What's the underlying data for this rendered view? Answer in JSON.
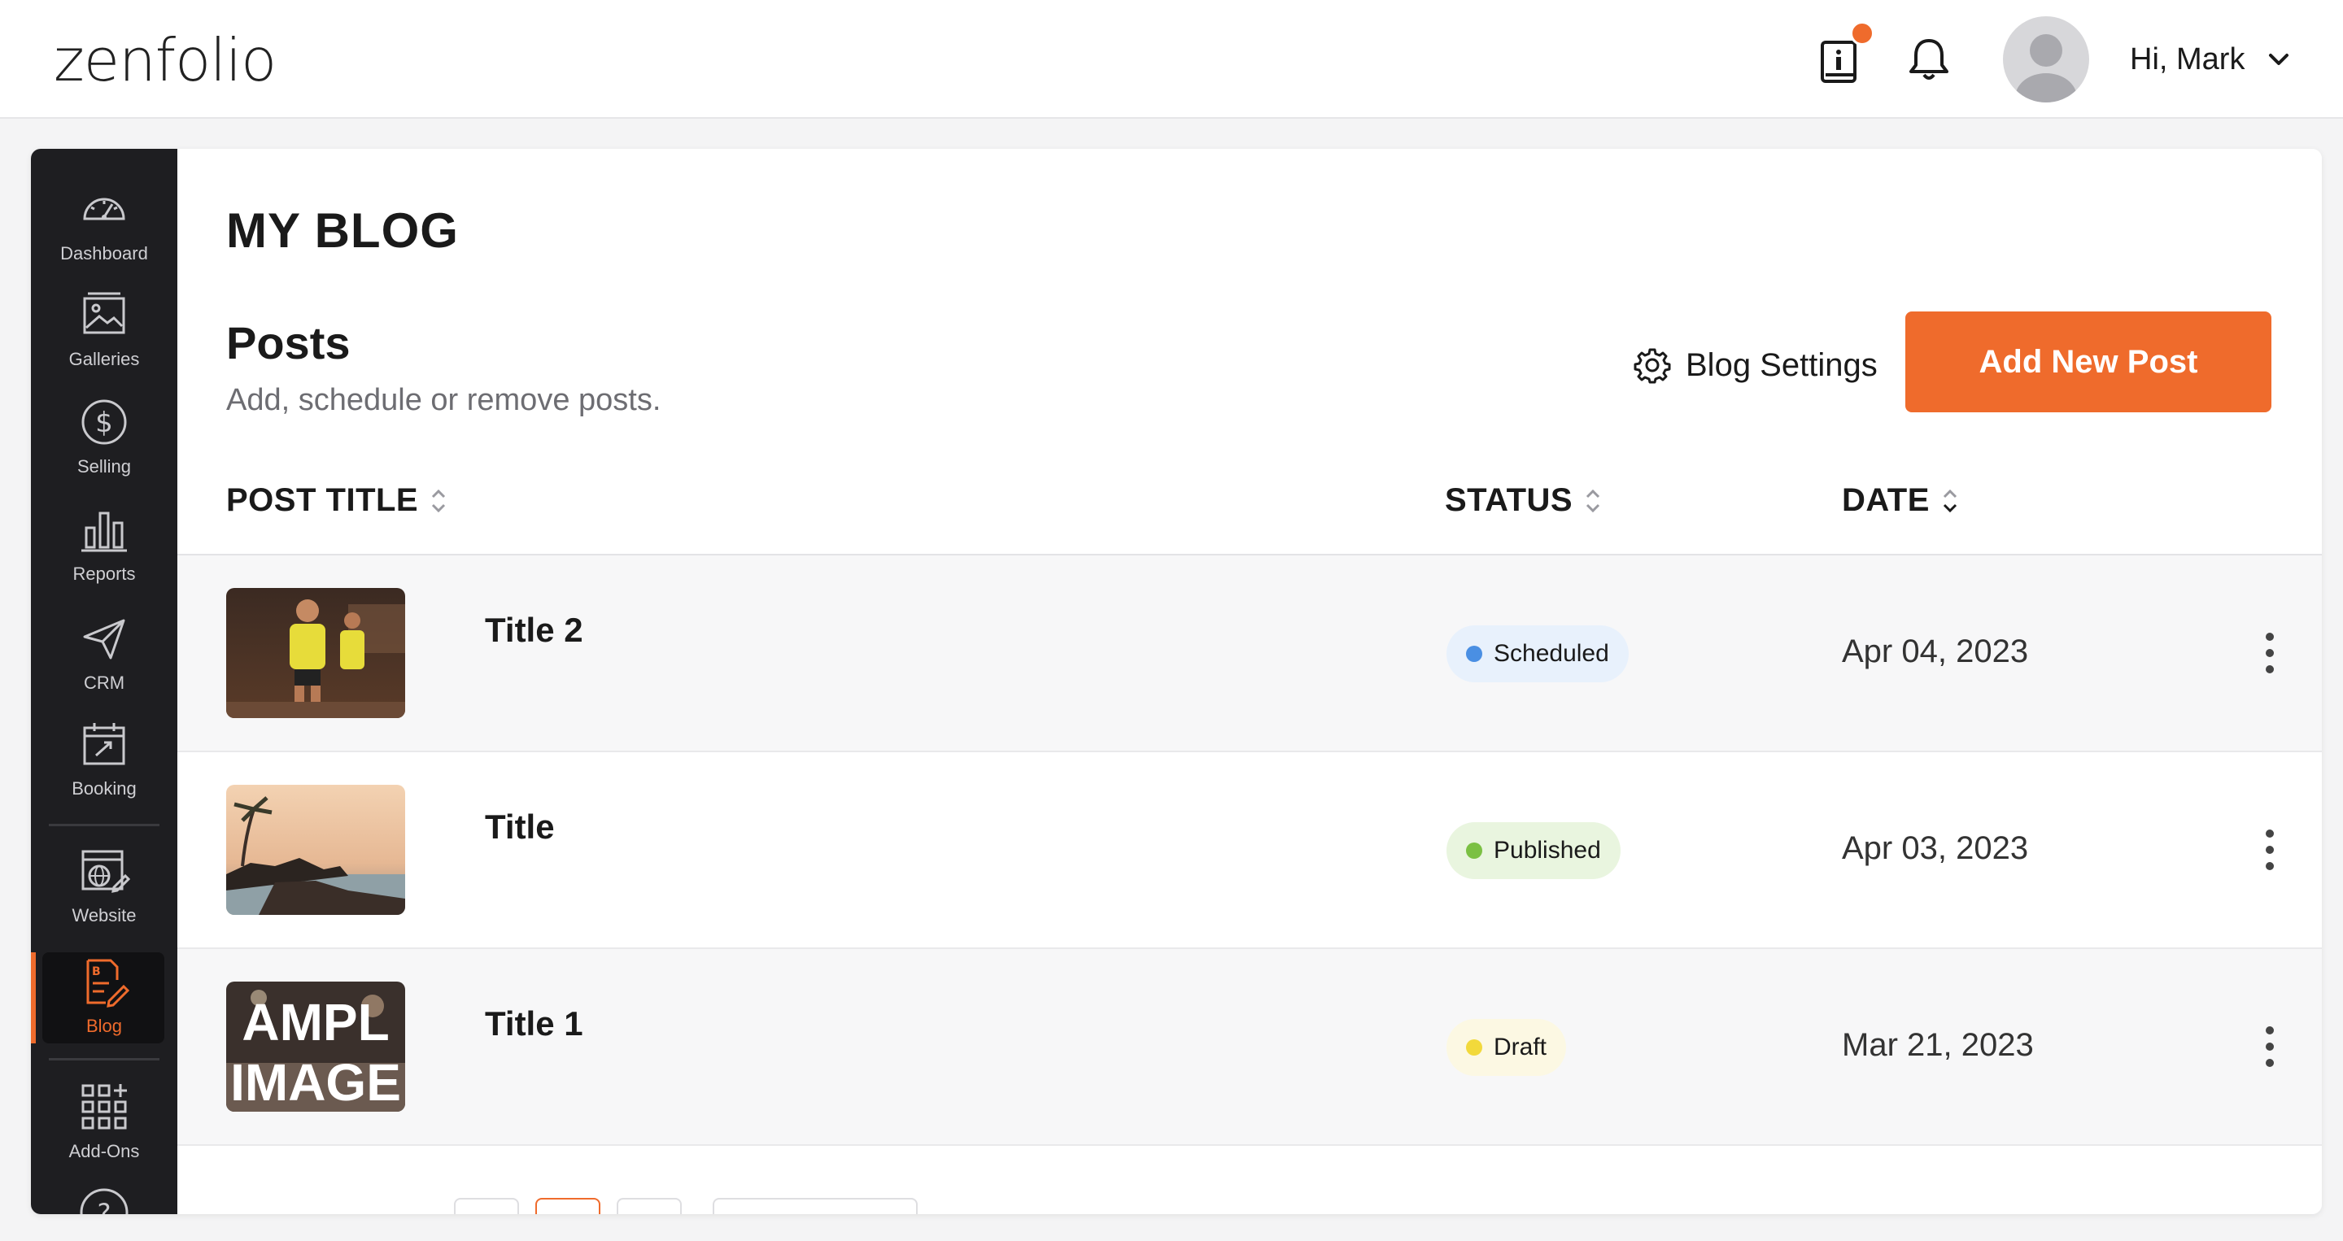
{
  "brand": {
    "logo_text": "zenfolio",
    "accent": "#ef6b2c"
  },
  "header": {
    "greeting": "Hi, Mark",
    "icons": [
      "info-book-icon",
      "bell-icon",
      "avatar",
      "chevron-down-icon"
    ]
  },
  "sidebar": {
    "items": [
      {
        "label": "Dashboard",
        "icon": "speedometer-icon"
      },
      {
        "label": "Galleries",
        "icon": "image-icon"
      },
      {
        "label": "Selling",
        "icon": "dollar-icon"
      },
      {
        "label": "Reports",
        "icon": "bar-chart-icon"
      },
      {
        "label": "CRM",
        "icon": "paper-plane-icon"
      },
      {
        "label": "Booking",
        "icon": "calendar-icon"
      },
      {
        "label": "Website",
        "icon": "website-edit-icon"
      },
      {
        "label": "Blog",
        "icon": "blog-edit-icon",
        "active": true
      },
      {
        "label": "Add-Ons",
        "icon": "grid-plus-icon"
      }
    ]
  },
  "main": {
    "page_title": "MY BLOG",
    "section_title": "Posts",
    "section_subtitle": "Add, schedule or remove posts.",
    "blog_settings_label": "Blog Settings",
    "add_post_label": "Add New Post",
    "columns": {
      "title": "POST TITLE",
      "status": "STATUS",
      "date": "DATE"
    },
    "rows": [
      {
        "title": "Title 2",
        "status": "Scheduled",
        "date": "Apr 04, 2023",
        "status_color": "#4a8fe3",
        "status_bg": "#e8f1fc"
      },
      {
        "title": "Title",
        "status": "Published",
        "date": "Apr 03, 2023",
        "status_color": "#7bc043",
        "status_bg": "#e9f5df"
      },
      {
        "title": "Title 1",
        "status": "Draft",
        "date": "Mar 21, 2023",
        "status_color": "#f2d93b",
        "status_bg": "#fcf8e3"
      }
    ],
    "sample_image_text": "AMPL IMAGE"
  }
}
